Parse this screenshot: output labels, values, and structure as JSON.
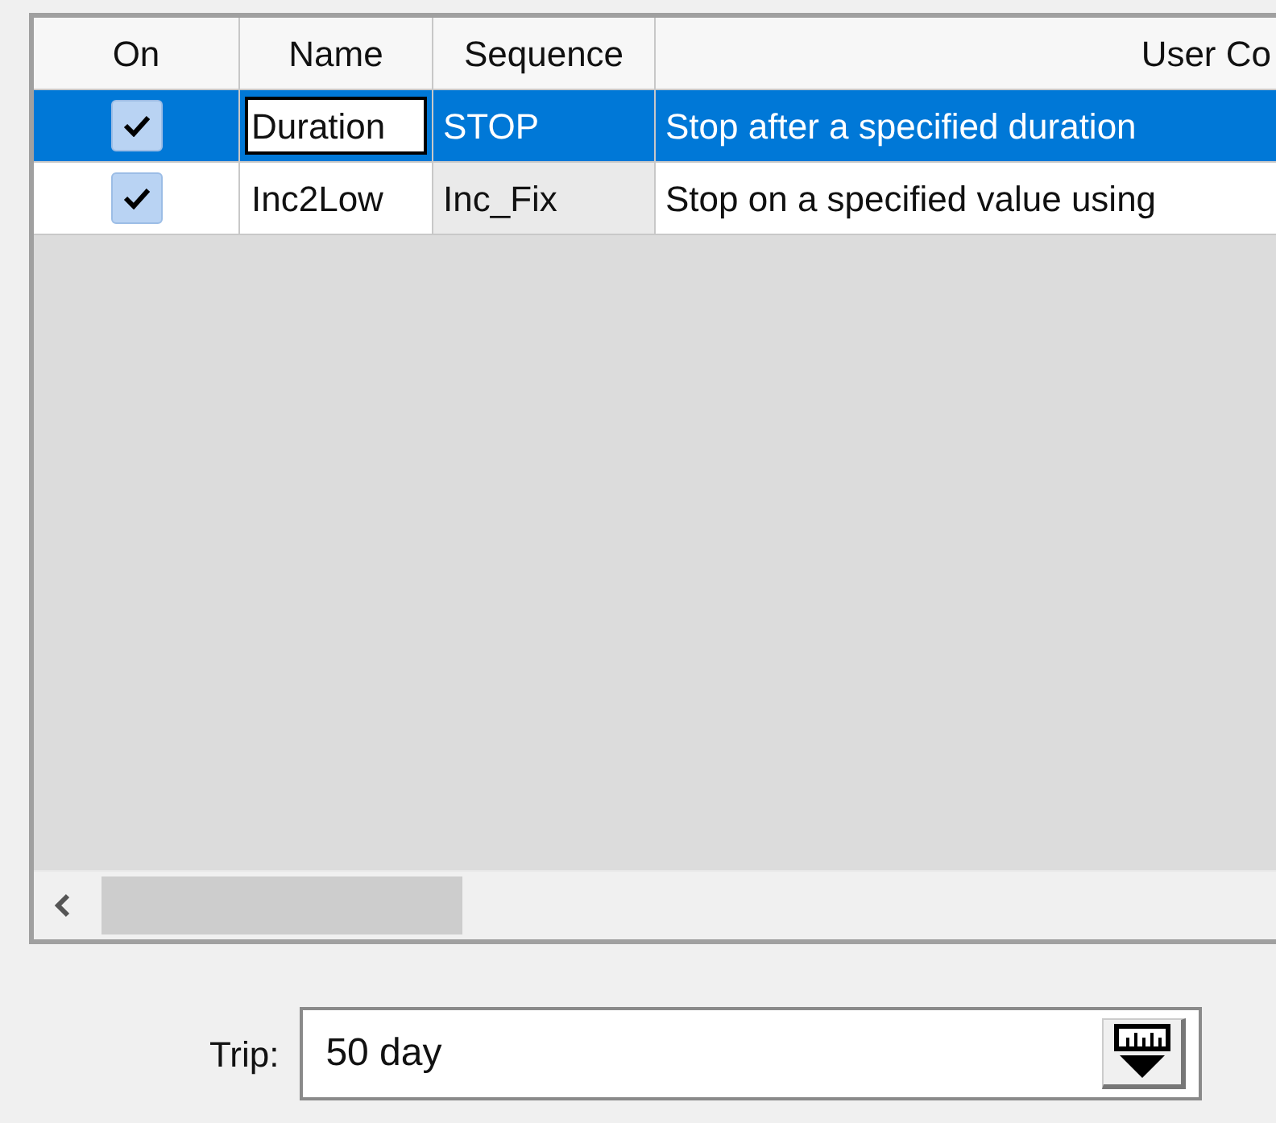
{
  "table": {
    "columns": [
      "On",
      "Name",
      "Sequence",
      "User Co"
    ],
    "rows": [
      {
        "selected": true,
        "checked": true,
        "editing": true,
        "name": "Duration",
        "sequence": "STOP",
        "column_4": "Stop after a specified duration"
      },
      {
        "selected": false,
        "checked": true,
        "editing": false,
        "name": "Inc2Low",
        "sequence": "Inc_Fix",
        "column_4": "Stop on a specified value using"
      }
    ]
  },
  "trip": {
    "label": "Trip:",
    "value": "50 day"
  }
}
